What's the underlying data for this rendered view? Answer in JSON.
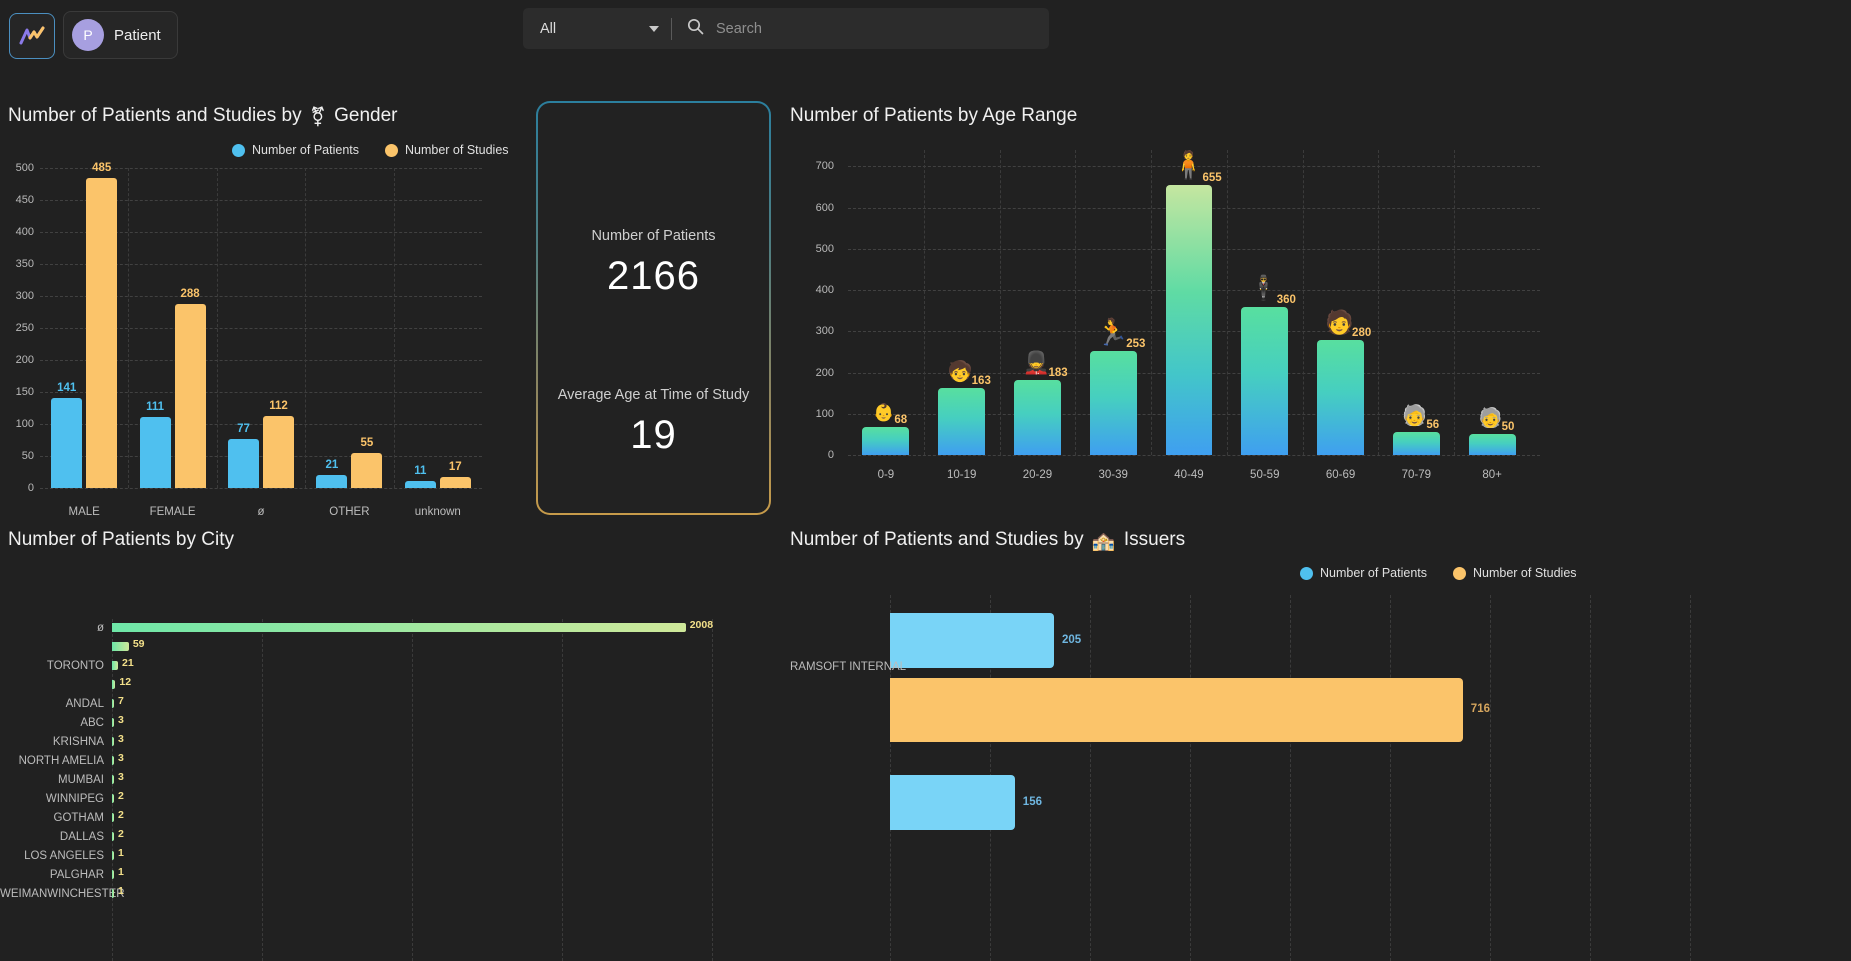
{
  "topbar": {
    "logo_icon": "chart-logo-icon",
    "patient_chip": {
      "avatar_initial": "P",
      "label": "Patient"
    },
    "search": {
      "scope_value": "All",
      "scope_icon": "chevron-down-icon",
      "search_icon": "search-icon",
      "placeholder": "Search"
    }
  },
  "panels": {
    "gender": {
      "title_prefix": "Number of Patients and Studies by",
      "title_symbol": "⚧",
      "title_suffix": "Gender"
    },
    "age": {
      "title": "Number of Patients by Age Range"
    },
    "city": {
      "title": "Number of Patients by City"
    },
    "issuers": {
      "title_prefix": "Number of Patients and Studies by",
      "title_symbol": "🏤",
      "title_suffix": "Issuers"
    }
  },
  "legend": {
    "patients": "Number of Patients",
    "studies": "Number of Studies",
    "patients_color": "#4fc0ef",
    "studies_color": "#fbc46a"
  },
  "kpi": {
    "patients_label": "Number of Patients",
    "patients_value": "2166",
    "avg_age_label": "Average Age at Time of Study",
    "avg_age_value": "19"
  },
  "chart_data": [
    {
      "id": "gender",
      "type": "bar",
      "title": "Number of Patients and Studies by ⚧ Gender",
      "xlabel": "",
      "ylabel": "",
      "grid": true,
      "legend_position": "top-right",
      "ylim": [
        0,
        500
      ],
      "yticks": [
        0,
        50,
        100,
        150,
        200,
        250,
        300,
        350,
        400,
        450,
        500
      ],
      "categories": [
        "MALE",
        "FEMALE",
        "ø",
        "OTHER",
        "unknown"
      ],
      "series": [
        {
          "name": "Number of Patients",
          "color": "#4fc0ef",
          "values": [
            141,
            111,
            77,
            21,
            11
          ]
        },
        {
          "name": "Number of Studies",
          "color": "#fbc46a",
          "values": [
            485,
            288,
            112,
            55,
            17
          ]
        }
      ]
    },
    {
      "id": "age",
      "type": "bar",
      "title": "Number of Patients by Age Range",
      "xlabel": "",
      "ylabel": "",
      "grid": true,
      "ylim": [
        0,
        700
      ],
      "yticks": [
        0,
        100,
        200,
        300,
        400,
        500,
        600,
        700
      ],
      "categories": [
        "0-9",
        "10-19",
        "20-29",
        "30-39",
        "40-49",
        "50-59",
        "60-69",
        "70-79",
        "80+"
      ],
      "values": [
        68,
        163,
        183,
        253,
        655,
        360,
        280,
        56,
        50
      ],
      "pictograms": [
        "baby",
        "child",
        "teen",
        "adult-running",
        "adult-standing",
        "adult-suit",
        "adult-senior",
        "elderly-cane",
        "elderly-cane"
      ]
    },
    {
      "id": "city",
      "type": "bar",
      "orientation": "horizontal",
      "title": "Number of Patients by City",
      "xlabel": "",
      "ylabel": "",
      "grid": true,
      "categories": [
        "ø",
        "",
        "TORONTO",
        "",
        "ANDAL",
        "ABC",
        "KRISHNA",
        "NORTH AMELIA",
        "MUMBAI",
        "WINNIPEG",
        "GOTHAM",
        "DALLAS",
        "LOS ANGELES",
        "PALGHAR",
        "WEIMANWINCHESTER"
      ],
      "values": [
        2008,
        59,
        21,
        12,
        7,
        3,
        3,
        3,
        3,
        2,
        2,
        2,
        1,
        1,
        1
      ],
      "xlim": [
        0,
        2100
      ]
    },
    {
      "id": "issuers",
      "type": "bar",
      "orientation": "horizontal",
      "title": "Number of Patients and Studies by 🏤 Issuers",
      "xlabel": "",
      "ylabel": "",
      "grid": true,
      "legend_position": "top-right",
      "categories": [
        "RAMSOFT INTERNAL",
        ""
      ],
      "series": [
        {
          "name": "Number of Patients",
          "color": "#79d4f7",
          "values": [
            205,
            156
          ]
        },
        {
          "name": "Number of Studies",
          "color": "#fbc46a",
          "values": [
            716,
            null
          ]
        }
      ],
      "xlim": [
        0,
        1000
      ]
    }
  ]
}
